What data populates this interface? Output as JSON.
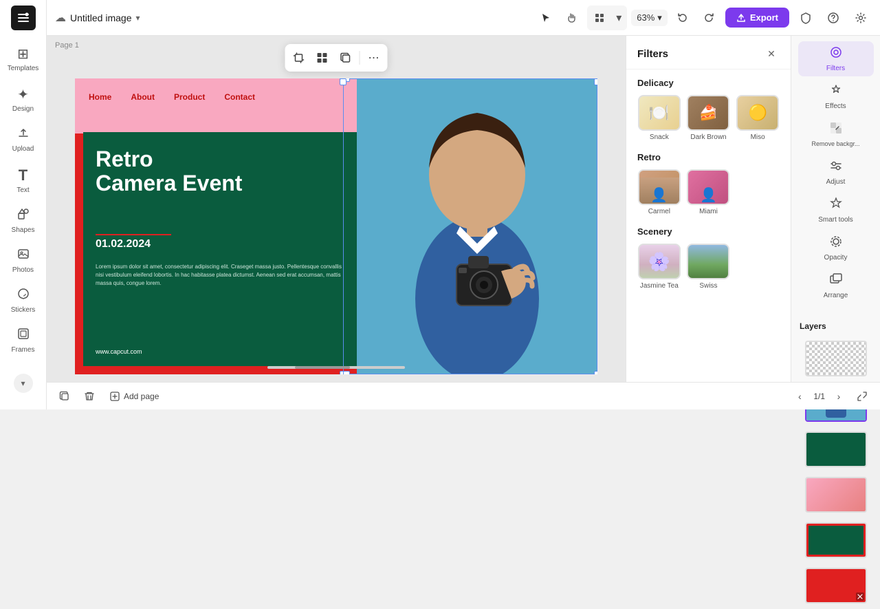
{
  "app": {
    "logo": "✕",
    "title": "Untitled image",
    "title_chevron": "▾"
  },
  "topbar": {
    "file_icon": "☁",
    "cursor_tool": "▶",
    "hand_tool": "✋",
    "layout_icon": "⊞",
    "zoom_level": "63%",
    "zoom_chevron": "▾",
    "undo_icon": "↩",
    "redo_icon": "↪",
    "export_label": "Export",
    "export_icon": "↑",
    "shield_icon": "🛡",
    "help_icon": "?",
    "settings_icon": "⚙"
  },
  "sidebar": {
    "items": [
      {
        "id": "templates",
        "label": "Templates",
        "icon": "⊞"
      },
      {
        "id": "design",
        "label": "Design",
        "icon": "✦"
      },
      {
        "id": "upload",
        "label": "Upload",
        "icon": "↑"
      },
      {
        "id": "text",
        "label": "Text",
        "icon": "T"
      },
      {
        "id": "shapes",
        "label": "Shapes",
        "icon": "◯"
      },
      {
        "id": "photos",
        "label": "Photos",
        "icon": "🖼"
      },
      {
        "id": "stickers",
        "label": "Stickers",
        "icon": "★"
      },
      {
        "id": "frames",
        "label": "Frames",
        "icon": "⬜"
      }
    ]
  },
  "canvas": {
    "page_label": "Page 1",
    "nav_items": [
      "Home",
      "About",
      "Product",
      "Contact"
    ],
    "headline": "Retro\nCamera Event",
    "date": "01.02.2024",
    "body_text": "Lorem ipsum dolor sit amet, consectetur adipiscing elit. Craseget massa justo. Pellentesque convallis nisi vestibulum eleifend lobortis. In hac habitasse platea dictumst. Aenean sed erat accumsan, mattis massa quis, congue lorem.",
    "url": "www.capcut.com"
  },
  "float_toolbar": {
    "btn1": "⊡",
    "btn2": "⊞",
    "btn3": "⧉",
    "btn4": "⋯"
  },
  "filters_panel": {
    "title": "Filters",
    "close_icon": "✕",
    "sections": [
      {
        "id": "delicacy",
        "label": "Delicacy",
        "items": [
          {
            "id": "snack",
            "label": "Snack",
            "selected": false
          },
          {
            "id": "dark_brown",
            "label": "Dark Brown",
            "selected": false
          },
          {
            "id": "miso",
            "label": "Miso",
            "selected": false
          }
        ]
      },
      {
        "id": "retro",
        "label": "Retro",
        "items": [
          {
            "id": "carmel",
            "label": "Carmel",
            "selected": false
          },
          {
            "id": "miami",
            "label": "Miami",
            "selected": false
          }
        ]
      },
      {
        "id": "scenery",
        "label": "Scenery",
        "items": [
          {
            "id": "jasmine_tea",
            "label": "Jasmine Tea",
            "selected": false
          },
          {
            "id": "swiss",
            "label": "Swiss",
            "selected": false
          }
        ]
      }
    ]
  },
  "right_panel": {
    "tabs": [
      {
        "id": "filters",
        "label": "Filters",
        "icon": "⊙",
        "active": true
      },
      {
        "id": "effects",
        "label": "Effects",
        "icon": "✦"
      },
      {
        "id": "remove_bg",
        "label": "Remove backgr...",
        "icon": "⊡"
      },
      {
        "id": "adjust",
        "label": "Adjust",
        "icon": "≡"
      },
      {
        "id": "smart_tools",
        "label": "Smart tools",
        "icon": "⚡"
      },
      {
        "id": "opacity",
        "label": "Opacity",
        "icon": "◎"
      },
      {
        "id": "arrange",
        "label": "Arrange",
        "icon": "⊞"
      }
    ],
    "layers_title": "Layers"
  },
  "bottom_bar": {
    "duplicate_icon": "⧉",
    "delete_icon": "🗑",
    "add_page_label": "Add page",
    "page_indicator": "1/1",
    "prev_icon": "‹",
    "next_icon": "›",
    "expand_icon": "⤢"
  }
}
